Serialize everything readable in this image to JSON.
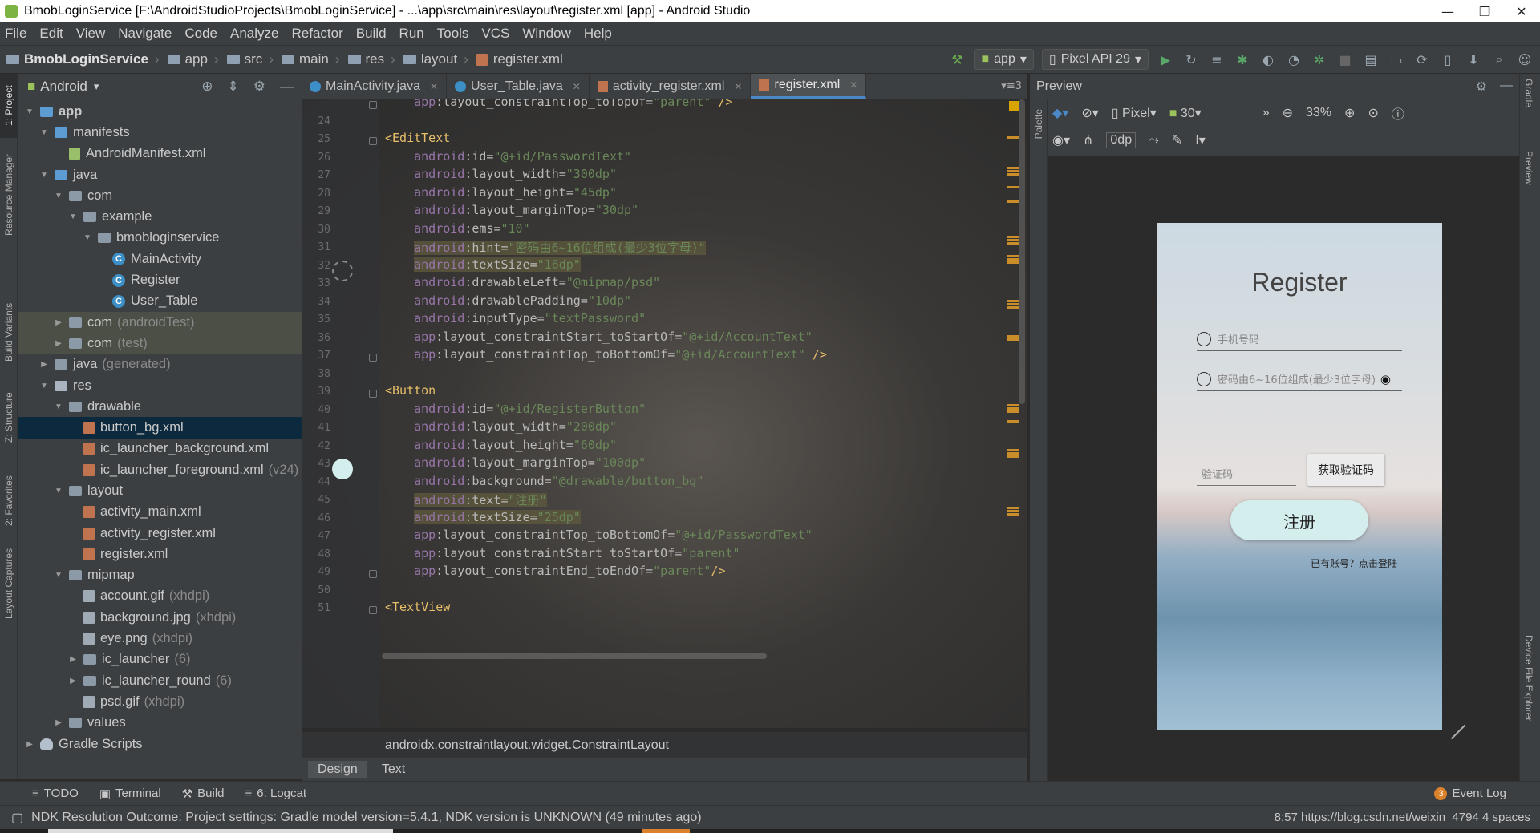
{
  "window": {
    "title": "BmobLoginService [F:\\AndroidStudioProjects\\BmobLoginService] - ...\\app\\src\\main\\res\\layout\\register.xml [app] - Android Studio",
    "minimize": "—",
    "maximize": "❐",
    "close": "✕"
  },
  "menu": [
    "File",
    "Edit",
    "View",
    "Navigate",
    "Code",
    "Analyze",
    "Refactor",
    "Build",
    "Run",
    "Tools",
    "VCS",
    "Window",
    "Help"
  ],
  "breadcrumbs": [
    "BmobLoginService",
    "app",
    "src",
    "main",
    "res",
    "layout",
    "register.xml"
  ],
  "toolbar": {
    "run_config": "app",
    "device": "Pixel API 29"
  },
  "left_tool_tabs": [
    "1: Project",
    "Resource Manager",
    "Build Variants",
    "Z: Structure",
    "2: Favorites",
    "Layout Captures"
  ],
  "project": {
    "view_mode": "Android",
    "tree": [
      {
        "label": "app",
        "depth": 0,
        "arrow": "▼",
        "icon": "folder-blue",
        "bold": true
      },
      {
        "label": "manifests",
        "depth": 1,
        "arrow": "▼",
        "icon": "folder-blue"
      },
      {
        "label": "AndroidManifest.xml",
        "depth": 2,
        "arrow": "",
        "icon": "manifest"
      },
      {
        "label": "java",
        "depth": 1,
        "arrow": "▼",
        "icon": "folder-blue"
      },
      {
        "label": "com",
        "depth": 2,
        "arrow": "▼",
        "icon": "package"
      },
      {
        "label": "example",
        "depth": 3,
        "arrow": "▼",
        "icon": "package"
      },
      {
        "label": "bmobloginservice",
        "depth": 4,
        "arrow": "▼",
        "icon": "package"
      },
      {
        "label": "MainActivity",
        "depth": 5,
        "arrow": "",
        "icon": "class"
      },
      {
        "label": "Register",
        "depth": 5,
        "arrow": "",
        "icon": "class"
      },
      {
        "label": "User_Table",
        "depth": 5,
        "arrow": "",
        "icon": "class"
      },
      {
        "label": "com",
        "suffix": "(androidTest)",
        "depth": 2,
        "arrow": "▶",
        "icon": "package",
        "highlight": true
      },
      {
        "label": "com",
        "suffix": "(test)",
        "depth": 2,
        "arrow": "▶",
        "icon": "package",
        "highlight": true
      },
      {
        "label": "java",
        "suffix": "(generated)",
        "depth": 1,
        "arrow": "▶",
        "icon": "folder-grey"
      },
      {
        "label": "res",
        "depth": 1,
        "arrow": "▼",
        "icon": "folder-res"
      },
      {
        "label": "drawable",
        "depth": 2,
        "arrow": "▼",
        "icon": "folder-grey"
      },
      {
        "label": "button_bg.xml",
        "depth": 3,
        "arrow": "",
        "icon": "xml",
        "selected": true
      },
      {
        "label": "ic_launcher_background.xml",
        "depth": 3,
        "arrow": "",
        "icon": "xml"
      },
      {
        "label": "ic_launcher_foreground.xml",
        "suffix": "(v24)",
        "depth": 3,
        "arrow": "",
        "icon": "xml"
      },
      {
        "label": "layout",
        "depth": 2,
        "arrow": "▼",
        "icon": "folder-grey"
      },
      {
        "label": "activity_main.xml",
        "depth": 3,
        "arrow": "",
        "icon": "xml"
      },
      {
        "label": "activity_register.xml",
        "depth": 3,
        "arrow": "",
        "icon": "xml"
      },
      {
        "label": "register.xml",
        "depth": 3,
        "arrow": "",
        "icon": "xml"
      },
      {
        "label": "mipmap",
        "depth": 2,
        "arrow": "▼",
        "icon": "folder-grey"
      },
      {
        "label": "account.gif",
        "suffix": "(xhdpi)",
        "depth": 3,
        "arrow": "",
        "icon": "image"
      },
      {
        "label": "background.jpg",
        "suffix": "(xhdpi)",
        "depth": 3,
        "arrow": "",
        "icon": "image"
      },
      {
        "label": "eye.png",
        "suffix": "(xhdpi)",
        "depth": 3,
        "arrow": "",
        "icon": "image"
      },
      {
        "label": "ic_launcher",
        "suffix": "(6)",
        "depth": 3,
        "arrow": "▶",
        "icon": "folder-grey"
      },
      {
        "label": "ic_launcher_round",
        "suffix": "(6)",
        "depth": 3,
        "arrow": "▶",
        "icon": "folder-grey"
      },
      {
        "label": "psd.gif",
        "suffix": "(xhdpi)",
        "depth": 3,
        "arrow": "",
        "icon": "image"
      },
      {
        "label": "values",
        "depth": 2,
        "arrow": "▶",
        "icon": "folder-grey"
      },
      {
        "label": "Gradle Scripts",
        "depth": 0,
        "arrow": "▶",
        "icon": "gradle"
      }
    ]
  },
  "editor_tabs": [
    {
      "label": "MainActivity.java",
      "icon": "class",
      "active": false
    },
    {
      "label": "User_Table.java",
      "icon": "class",
      "active": false
    },
    {
      "label": "activity_register.xml",
      "icon": "xml",
      "active": false
    },
    {
      "label": "register.xml",
      "icon": "xml",
      "active": true
    }
  ],
  "code_lines": [
    {
      "n": "",
      "indent": "    ",
      "parts": [
        [
          "ns",
          "app"
        ],
        [
          "attr",
          ":layout_constraintTop_toTopOf="
        ],
        [
          "val",
          "\"parent\""
        ],
        [
          "tag",
          " />"
        ]
      ]
    },
    {
      "n": "24",
      "indent": "",
      "parts": []
    },
    {
      "n": "25",
      "indent": "",
      "parts": [
        [
          "tag",
          "<EditText"
        ]
      ]
    },
    {
      "n": "26",
      "indent": "    ",
      "parts": [
        [
          "ns",
          "android"
        ],
        [
          "attr",
          ":id="
        ],
        [
          "val",
          "\"@+id/PasswordText\""
        ]
      ]
    },
    {
      "n": "27",
      "indent": "    ",
      "parts": [
        [
          "ns",
          "android"
        ],
        [
          "attr",
          ":layout_width="
        ],
        [
          "val",
          "\"300dp\""
        ]
      ]
    },
    {
      "n": "28",
      "indent": "    ",
      "parts": [
        [
          "ns",
          "android"
        ],
        [
          "attr",
          ":layout_height="
        ],
        [
          "val",
          "\"45dp\""
        ]
      ]
    },
    {
      "n": "29",
      "indent": "    ",
      "parts": [
        [
          "ns",
          "android"
        ],
        [
          "attr",
          ":layout_marginTop="
        ],
        [
          "val",
          "\"30dp\""
        ]
      ]
    },
    {
      "n": "30",
      "indent": "    ",
      "parts": [
        [
          "ns",
          "android"
        ],
        [
          "attr",
          ":ems="
        ],
        [
          "val",
          "\"10\""
        ]
      ]
    },
    {
      "n": "31",
      "indent": "    ",
      "parts": [
        [
          "ns",
          "android"
        ],
        [
          "attr",
          ":hint="
        ],
        [
          "val",
          "\"密码由6~16位组成(最少3位字母)\""
        ]
      ],
      "hl": true
    },
    {
      "n": "32",
      "indent": "    ",
      "parts": [
        [
          "ns",
          "android"
        ],
        [
          "attr",
          ":textSize="
        ],
        [
          "val",
          "\"16dp\""
        ]
      ],
      "hl": true
    },
    {
      "n": "33",
      "indent": "    ",
      "parts": [
        [
          "ns",
          "android"
        ],
        [
          "attr",
          ":drawableLeft="
        ],
        [
          "val",
          "\"@mipmap/psd\""
        ]
      ]
    },
    {
      "n": "34",
      "indent": "    ",
      "parts": [
        [
          "ns",
          "android"
        ],
        [
          "attr",
          ":drawablePadding="
        ],
        [
          "val",
          "\"10dp\""
        ]
      ]
    },
    {
      "n": "35",
      "indent": "    ",
      "parts": [
        [
          "ns",
          "android"
        ],
        [
          "attr",
          ":inputType="
        ],
        [
          "val",
          "\"textPassword\""
        ]
      ]
    },
    {
      "n": "36",
      "indent": "    ",
      "parts": [
        [
          "ns",
          "app"
        ],
        [
          "attr",
          ":layout_constraintStart_toStartOf="
        ],
        [
          "val",
          "\"@+id/AccountText\""
        ]
      ]
    },
    {
      "n": "37",
      "indent": "    ",
      "parts": [
        [
          "ns",
          "app"
        ],
        [
          "attr",
          ":layout_constraintTop_toBottomOf="
        ],
        [
          "val",
          "\"@+id/AccountText\""
        ],
        [
          "tag",
          " />"
        ]
      ]
    },
    {
      "n": "38",
      "indent": "",
      "parts": []
    },
    {
      "n": "39",
      "indent": "",
      "parts": [
        [
          "tag",
          "<Button"
        ]
      ]
    },
    {
      "n": "40",
      "indent": "    ",
      "parts": [
        [
          "ns",
          "android"
        ],
        [
          "attr",
          ":id="
        ],
        [
          "val",
          "\"@+id/RegisterButton\""
        ]
      ]
    },
    {
      "n": "41",
      "indent": "    ",
      "parts": [
        [
          "ns",
          "android"
        ],
        [
          "attr",
          ":layout_width="
        ],
        [
          "val",
          "\"200dp\""
        ]
      ]
    },
    {
      "n": "42",
      "indent": "    ",
      "parts": [
        [
          "ns",
          "android"
        ],
        [
          "attr",
          ":layout_height="
        ],
        [
          "val",
          "\"60dp\""
        ]
      ]
    },
    {
      "n": "43",
      "indent": "    ",
      "parts": [
        [
          "ns",
          "android"
        ],
        [
          "attr",
          ":layout_marginTop="
        ],
        [
          "val",
          "\"100dp\""
        ]
      ]
    },
    {
      "n": "44",
      "indent": "    ",
      "parts": [
        [
          "ns",
          "android"
        ],
        [
          "attr",
          ":background="
        ],
        [
          "val",
          "\"@drawable/button_bg\""
        ]
      ]
    },
    {
      "n": "45",
      "indent": "    ",
      "parts": [
        [
          "ns",
          "android"
        ],
        [
          "attr",
          ":text="
        ],
        [
          "val",
          "\"注册\""
        ]
      ],
      "hl": true
    },
    {
      "n": "46",
      "indent": "    ",
      "parts": [
        [
          "ns",
          "android"
        ],
        [
          "attr",
          ":textSize="
        ],
        [
          "val",
          "\"25dp\""
        ]
      ],
      "hl": true
    },
    {
      "n": "47",
      "indent": "    ",
      "parts": [
        [
          "ns",
          "app"
        ],
        [
          "attr",
          ":layout_constraintTop_toBottomOf="
        ],
        [
          "val",
          "\"@+id/PasswordText\""
        ]
      ]
    },
    {
      "n": "48",
      "indent": "    ",
      "parts": [
        [
          "ns",
          "app"
        ],
        [
          "attr",
          ":layout_constraintStart_toStartOf="
        ],
        [
          "val",
          "\"parent\""
        ]
      ]
    },
    {
      "n": "49",
      "indent": "    ",
      "parts": [
        [
          "ns",
          "app"
        ],
        [
          "attr",
          ":layout_constraintEnd_toEndOf="
        ],
        [
          "val",
          "\"parent\""
        ],
        [
          "tag",
          "/>"
        ]
      ]
    },
    {
      "n": "50",
      "indent": "",
      "parts": []
    },
    {
      "n": "51",
      "indent": "",
      "parts": [
        [
          "tag",
          "<TextView"
        ]
      ]
    }
  ],
  "editor_breadcrumb": "androidx.constraintlayout.widget.ConstraintLayout",
  "design_tabs": [
    "Design",
    "Text"
  ],
  "preview": {
    "title": "Preview",
    "device": "Pixel",
    "api": "30",
    "zoom": "33%",
    "margin": "0dp",
    "palette_label": "Palette",
    "screen": {
      "title": "Register",
      "phone_hint": "手机号码",
      "password_hint": "密码由6~16位组成(最少3位字母)",
      "code_hint": "验证码",
      "get_code": "获取验证码",
      "register": "注册",
      "have_account": "已有账号？点击登陆"
    }
  },
  "right_tool_tabs": [
    "Gradle",
    "Preview",
    "Device File Explorer"
  ],
  "bottom_tools": [
    {
      "label": "TODO",
      "icon": "≡"
    },
    {
      "label": "Terminal",
      "icon": "▣"
    },
    {
      "label": "Build",
      "icon": "⚒"
    },
    {
      "label": "6: Logcat",
      "icon": "≡"
    }
  ],
  "event_log": {
    "label": "Event Log",
    "count": "3"
  },
  "status": {
    "message": "NDK Resolution Outcome: Project settings: Gradle model version=5.4.1, NDK version is UNKNOWN (49 minutes ago)",
    "right": "8:57  https://blog.csdn.net/weixin_4794  4 spaces"
  },
  "colors": {
    "accent": "#4a88c7",
    "selection": "#0d293e",
    "ide_bg": "#2b2b2b",
    "panel_bg": "#3c3f41"
  }
}
